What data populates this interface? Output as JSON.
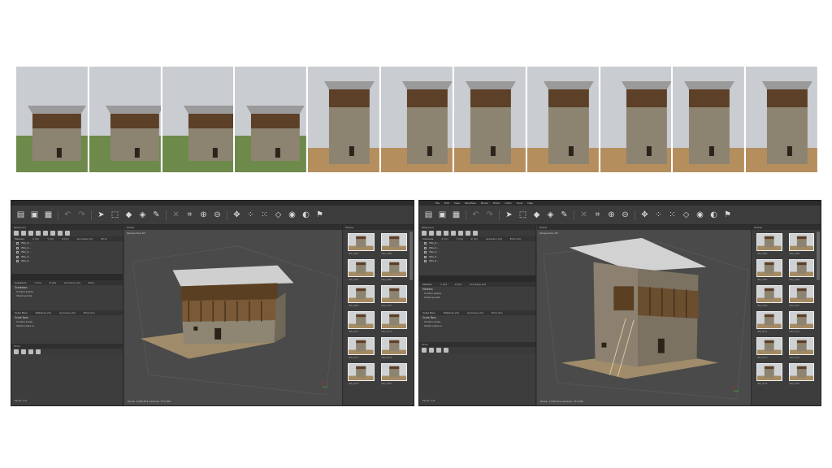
{
  "photo_strip": {
    "count": 11
  },
  "left_window": {
    "toolbar_icons": [
      "file-icon",
      "open-icon",
      "save-icon",
      "undo-icon",
      "redo-icon",
      "pointer-icon",
      "rect-select-icon",
      "model-icon",
      "shading-icon",
      "ruler-icon",
      "delete-icon",
      "crop-icon",
      "zoom-in-icon",
      "zoom-out-icon",
      "move-icon",
      "points-icon",
      "grid-icon",
      "view-icon",
      "camera-icon",
      "photo-icon",
      "flag-icon"
    ],
    "workspace_title": "Reference",
    "markers_header": [
      "Markers",
      "X (m)",
      "Y (m)",
      "Z (m)",
      "Accuracy (m)",
      "Error"
    ],
    "markers": [
      "IMG_0...",
      "IMG_0...",
      "IMG_0...",
      "IMG_0...",
      "IMG_0..."
    ],
    "scalebars_header": [
      "Scalebars",
      "Y (m)",
      "Z (m)",
      "Accuracy (m)",
      "Error"
    ],
    "scalebars_items": [
      "Control points",
      "Check points"
    ],
    "scalebars_sub": [
      "Scale Bars",
      "Distance (m)",
      "Accuracy (m)",
      "Error (m)"
    ],
    "scalebars_sub_items": [
      "Control scale...",
      "Check scale b..."
    ],
    "tools_title": "Tools",
    "status_text": "Faces: 4.0",
    "model_title": "Model",
    "perspective": "Perspective 30°",
    "model_status": "Faces: 1,505,671 vertices: 777,295",
    "photos_title": "Photos",
    "thumbs": [
      "IMG_0265",
      "IMG_0266",
      "IMG_0267",
      "IMG_0268",
      "IMG_0269",
      "IMG_0270",
      "IMG_0271",
      "IMG_0272",
      "IMG_0273",
      "IMG_0274",
      "IMG_0275",
      "IMG_0276"
    ]
  },
  "right_window": {
    "menu": [
      "File",
      "Edit",
      "View",
      "Workflow",
      "Model",
      "Photo",
      "Ortho",
      "Tools",
      "Help"
    ],
    "workspace_title": "Reference",
    "markers_header": [
      "Cameras",
      "X (m)",
      "Y (m)",
      "Z (m)",
      "Accuracy (m)",
      "Error (m)"
    ],
    "markers": [
      "IMG_0...",
      "IMG_0...",
      "IMG_0...",
      "IMG_0...",
      "IMG_0..."
    ],
    "scalebars_header": [
      "Markers",
      "Y (m)",
      "Z (m)",
      "Accuracy (m)"
    ],
    "scalebars_items": [
      "Control points",
      "Check points"
    ],
    "scalebars_sub": [
      "Scale Bars",
      "Distance (m)",
      "Accuracy (m)",
      "Error (m)"
    ],
    "scalebars_sub_items": [
      "Control scale...",
      "Check scale b..."
    ],
    "tools_title": "Tools",
    "status_text": "Faces: 1.8",
    "model_title": "Model",
    "perspective": "Perspective 30°",
    "model_status": "Faces: 1,505,671 vertices: 777,295",
    "photos_title": "Photos",
    "thumbs": [
      "IMG_0265",
      "IMG_0266",
      "IMG_0267",
      "IMG_0268",
      "IMG_0269",
      "IMG_0270",
      "IMG_0271",
      "IMG_0272",
      "IMG_0273",
      "IMG_0274",
      "IMG_0275",
      "IMG_0276"
    ]
  },
  "colors": {
    "app_bg": "#3a3a3a",
    "viewport_bg": "#4a4a4a",
    "stone": "#8c8170",
    "timber": "#6b4e2e",
    "roof": "#c9c9c9"
  }
}
